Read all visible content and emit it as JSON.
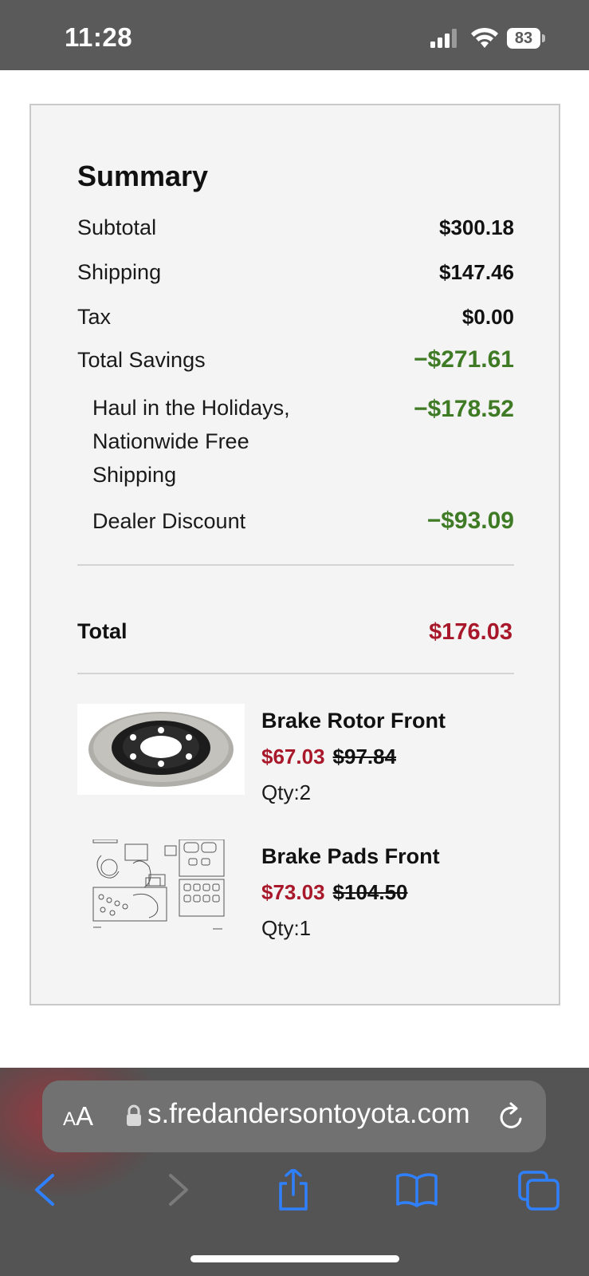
{
  "status_bar": {
    "time": "11:28",
    "battery_level": "83"
  },
  "summary": {
    "title": "Summary",
    "rows": [
      {
        "label": "Subtotal",
        "value": "$300.18"
      },
      {
        "label": "Shipping",
        "value": "$147.46"
      },
      {
        "label": "Tax",
        "value": "$0.00"
      },
      {
        "label": "Total Savings",
        "value": "−$271.61"
      }
    ],
    "savings_breakdown": [
      {
        "label": "Haul in the Holidays, Nationwide Free Shipping",
        "value": "−$178.52"
      },
      {
        "label": "Dealer Discount",
        "value": "−$93.09"
      }
    ],
    "total_label": "Total",
    "total_value": "$176.03",
    "colors": {
      "savings_green": "#3f7a25",
      "price_red": "#a8182a",
      "card_bg": "#f4f4f4"
    }
  },
  "products": [
    {
      "name": "Brake Rotor Front",
      "sale_price": "$67.03",
      "original_price": "$97.84",
      "qty": "Qty:2",
      "image_icon": "brake-rotor-photo"
    },
    {
      "name": "Brake Pads Front",
      "sale_price": "$73.03",
      "original_price": "$104.50",
      "qty": "Qty:1",
      "image_icon": "brake-pads-diagram"
    }
  ],
  "browser": {
    "aa_label_small": "A",
    "aa_label_large": "A",
    "url": "s.fredandersontoyota.com",
    "toolbar": [
      "back-icon",
      "forward-icon",
      "share-icon",
      "bookmarks-icon",
      "tabs-icon"
    ]
  }
}
